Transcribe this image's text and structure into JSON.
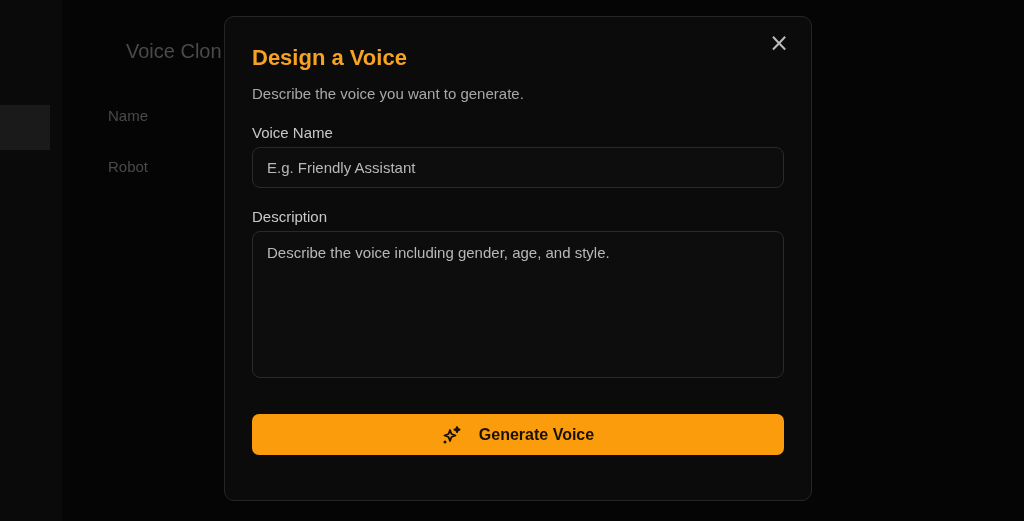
{
  "page": {
    "title": "Voice Clon",
    "table": {
      "column_1": "Name",
      "rows": [
        "Robot"
      ]
    }
  },
  "dialog": {
    "title": "Design a Voice",
    "subtitle": "Describe the voice you want to generate.",
    "close": "×",
    "fields": [
      {
        "kind": "input",
        "label": "Voice Name",
        "placeholder": "E.g. Friendly Assistant"
      },
      {
        "kind": "textarea",
        "label": "Description",
        "placeholder": "Describe the voice including gender, age, and style."
      }
    ],
    "button": "Generate Voice"
  }
}
